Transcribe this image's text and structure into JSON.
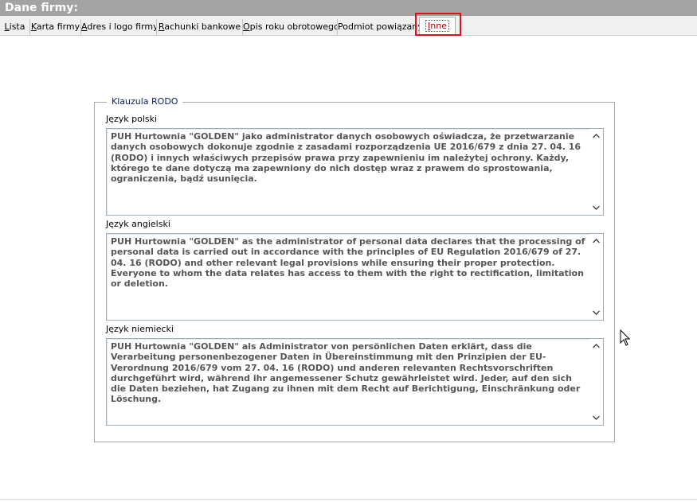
{
  "window": {
    "title": "Dane firmy:"
  },
  "tabs": [
    {
      "label": "Lista",
      "accel": "L",
      "rest": "ista"
    },
    {
      "label": "Karta firmy",
      "accel": "K",
      "rest": "arta firmy"
    },
    {
      "label": "Adres i logo firmy",
      "accel": "A",
      "rest": "dres i logo firmy"
    },
    {
      "label": "Rachunki bankowe",
      "accel": "R",
      "rest": "achunki bankowe"
    },
    {
      "label": "Opis roku obrotowego",
      "accel": "O",
      "rest": "pis roku obrotowego"
    },
    {
      "label": "Podmiot powiązany",
      "accel": "",
      "rest": "Podmiot powiązany"
    },
    {
      "label": "Inne",
      "accel": "I",
      "rest": "nne"
    }
  ],
  "group": {
    "title": "Klauzula RODO",
    "fields": [
      {
        "label": "Język polski",
        "value": "PUH Hurtownia \"GOLDEN\" jako administrator danych osobowych oświadcza, że przetwarzanie danych osobowych dokonuje zgodnie z zasadami rozporządzenia UE 2016/679 z dnia 27. 04. 16 (RODO) i innych właściwych przepisów prawa przy zapewnieniu im należytej ochrony. Każdy, którego te dane dotyczą ma zapewniony do nich dostęp wraz z prawem do sprostowania, ograniczenia, bądź usunięcia."
      },
      {
        "label": "Język angielski",
        "value": "PUH Hurtownia \"GOLDEN\" as the administrator of personal data declares that the processing of personal data is carried out in accordance with the principles of EU Regulation 2016/679 of 27. 04. 16 (RODO) and other relevant legal provisions while ensuring their proper protection. Everyone to whom the data relates has access to them with the right to rectification, limitation or deletion."
      },
      {
        "label": "Język niemiecki",
        "value": "PUH Hurtownia \"GOLDEN\" als Administrator von persönlichen Daten erklärt, dass die Verarbeitung personenbezogener Daten in Übereinstimmung mit den Prinzipien der EU-Verordnung 2016/679 vom 27. 04. 16 (RODO) und anderen relevanten Rechtsvorschriften durchgeführt wird, während ihr angemessener Schutz gewährleistet wird. Jeder, auf den sich die Daten beziehen, hat Zugang zu ihnen mit dem Recht auf Berichtigung, Einschränkung oder Löschung."
      }
    ]
  },
  "icons": {
    "scroll_up": "chevron-up-icon",
    "scroll_down": "chevron-down-icon",
    "cursor": "mouse-pointer-icon"
  },
  "colors": {
    "titlebar": "#a3a3a3",
    "highlight": "#e0101e",
    "legend_text": "#0a246a",
    "memo_text": "#555555"
  }
}
